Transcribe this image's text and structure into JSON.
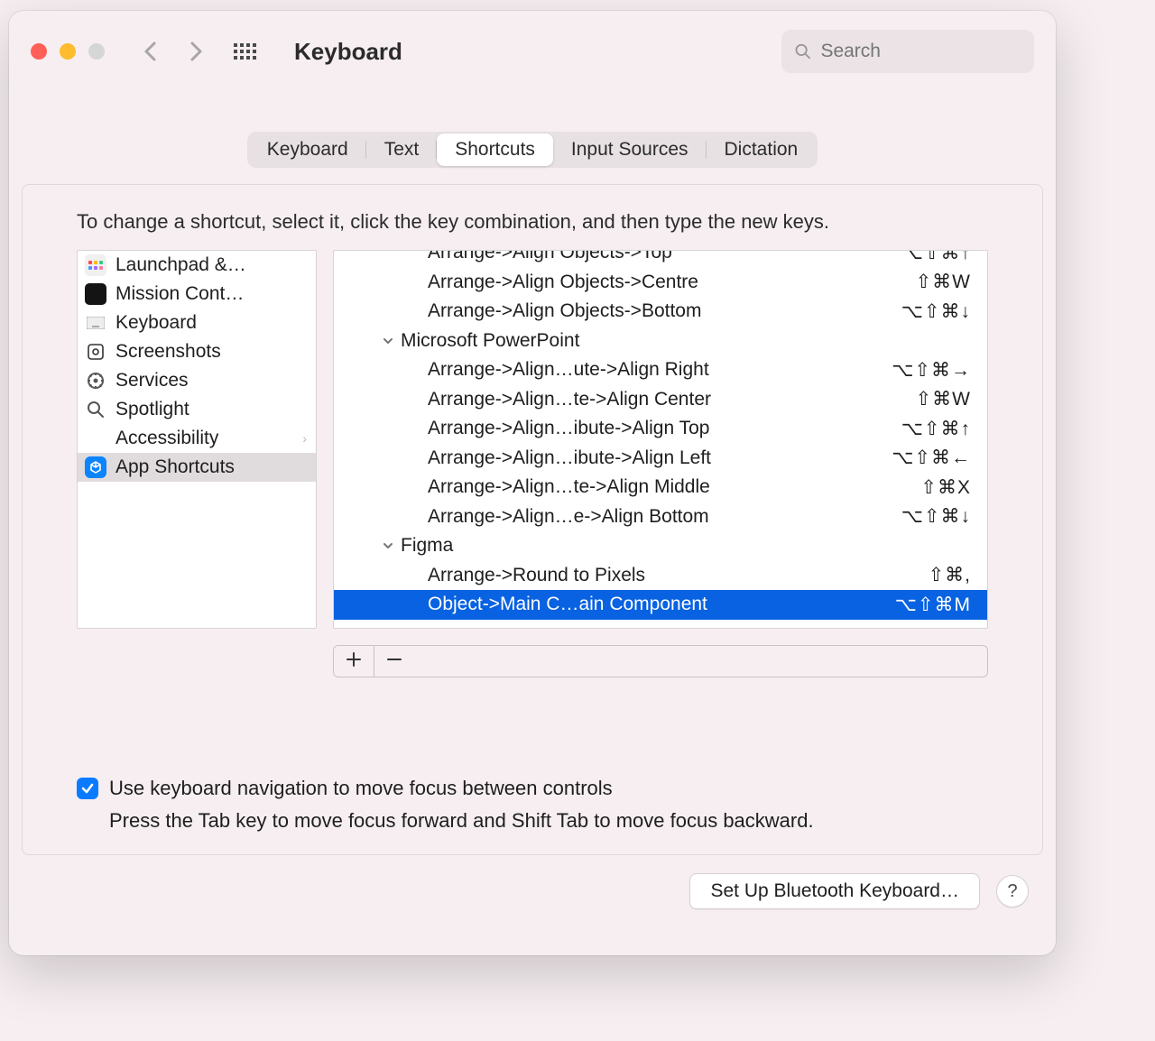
{
  "window": {
    "title": "Keyboard"
  },
  "search": {
    "placeholder": "Search"
  },
  "tabs": [
    {
      "label": "Keyboard",
      "active": false
    },
    {
      "label": "Text",
      "active": false
    },
    {
      "label": "Shortcuts",
      "active": true
    },
    {
      "label": "Input Sources",
      "active": false
    },
    {
      "label": "Dictation",
      "active": false
    }
  ],
  "instruction": "To change a shortcut, select it, click the key combination, and then type the new keys.",
  "sidebar": [
    {
      "icon": "launchpad",
      "label": "Launchpad &…",
      "selected": false
    },
    {
      "icon": "mission",
      "label": "Mission Cont…",
      "selected": false
    },
    {
      "icon": "keyboard",
      "label": "Keyboard",
      "selected": false
    },
    {
      "icon": "screenshots",
      "label": "Screenshots",
      "selected": false
    },
    {
      "icon": "services",
      "label": "Services",
      "selected": false
    },
    {
      "icon": "spotlight",
      "label": "Spotlight",
      "selected": false
    },
    {
      "icon": "accessibility",
      "label": "Accessibility",
      "selected": false,
      "reveal": true
    },
    {
      "icon": "apps",
      "label": "App Shortcuts",
      "selected": true
    }
  ],
  "tree": [
    {
      "indent": 2,
      "name": "Arrange->Align Objects->Top",
      "shortcut": "⌥⇧⌘↑",
      "partial": true,
      "selected": false
    },
    {
      "indent": 2,
      "name": "Arrange->Align Objects->Centre",
      "shortcut": "⇧⌘W",
      "selected": false
    },
    {
      "indent": 2,
      "name": "Arrange->Align Objects->Bottom",
      "shortcut": "⌥⇧⌘↓",
      "selected": false
    },
    {
      "indent": 1,
      "name": "Microsoft PowerPoint",
      "shortcut": "",
      "group": true,
      "open": true,
      "selected": false
    },
    {
      "indent": 2,
      "name": "Arrange->Align…ute->Align Right",
      "shortcut": "⌥⇧⌘→",
      "selected": false
    },
    {
      "indent": 2,
      "name": "Arrange->Align…te->Align Center",
      "shortcut": "⇧⌘W",
      "selected": false
    },
    {
      "indent": 2,
      "name": "Arrange->Align…ibute->Align Top",
      "shortcut": "⌥⇧⌘↑",
      "selected": false
    },
    {
      "indent": 2,
      "name": "Arrange->Align…ibute->Align Left",
      "shortcut": "⌥⇧⌘←",
      "selected": false
    },
    {
      "indent": 2,
      "name": "Arrange->Align…te->Align Middle",
      "shortcut": "⇧⌘X",
      "selected": false
    },
    {
      "indent": 2,
      "name": "Arrange->Align…e->Align Bottom",
      "shortcut": "⌥⇧⌘↓",
      "selected": false
    },
    {
      "indent": 1,
      "name": "Figma",
      "shortcut": "",
      "group": true,
      "open": true,
      "selected": false
    },
    {
      "indent": 2,
      "name": "Arrange->Round to Pixels",
      "shortcut": "⇧⌘,",
      "selected": false
    },
    {
      "indent": 2,
      "name": "Object->Main C…ain Component",
      "shortcut": "⌥⇧⌘M",
      "selected": true
    }
  ],
  "kbnav": {
    "checked": true,
    "label": "Use keyboard navigation to move focus between controls",
    "hint": "Press the Tab key to move focus forward and Shift Tab to move focus backward."
  },
  "footer": {
    "bluetooth": "Set Up Bluetooth Keyboard…"
  }
}
